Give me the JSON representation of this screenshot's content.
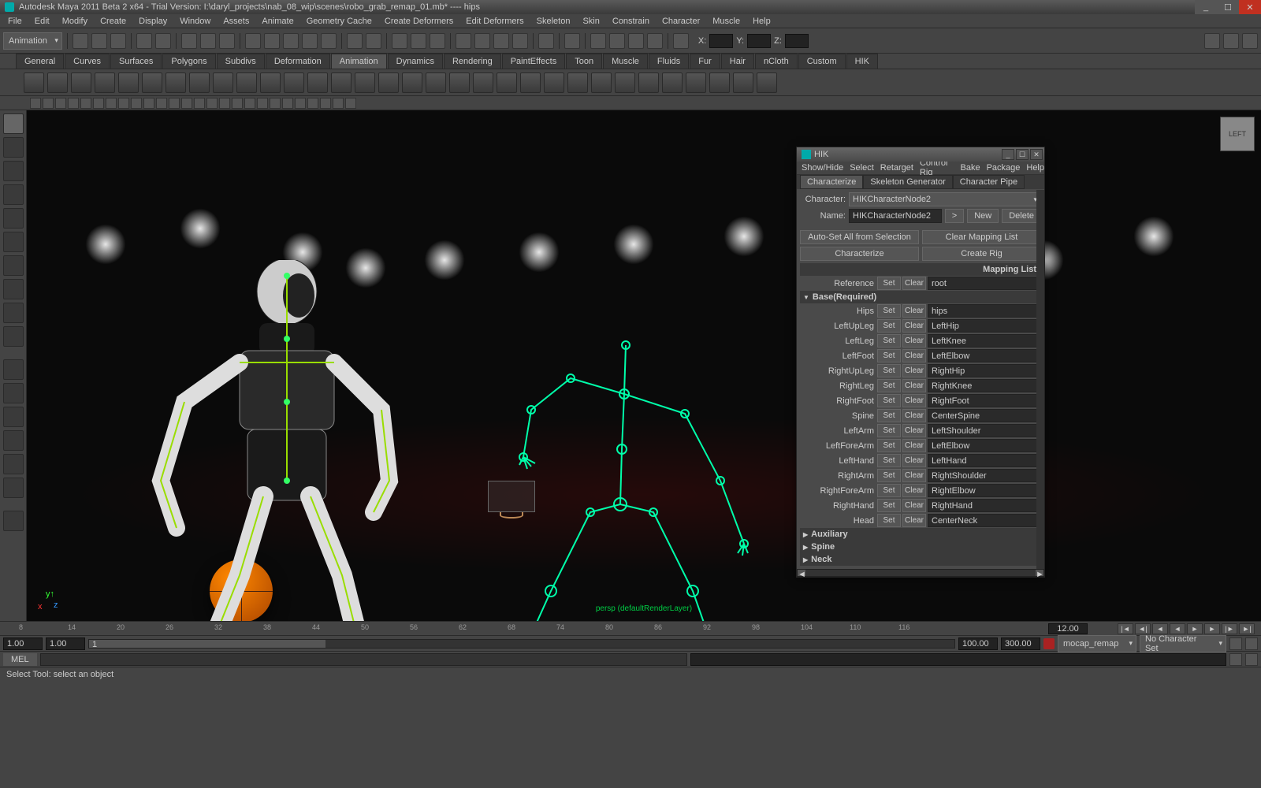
{
  "title": "Autodesk Maya 2011 Beta 2 x64 - Trial Version: I:\\daryl_projects\\nab_08_wip\\scenes\\robo_grab_remap_01.mb*  ----  hips",
  "menubar": [
    "File",
    "Edit",
    "Modify",
    "Create",
    "Display",
    "Window",
    "Assets",
    "Animate",
    "Geometry Cache",
    "Create Deformers",
    "Edit Deformers",
    "Skeleton",
    "Skin",
    "Constrain",
    "Character",
    "Muscle",
    "Help"
  ],
  "modeDropdown": "Animation",
  "xyz": {
    "x": "X:",
    "y": "Y:",
    "z": "Z:"
  },
  "shelftabs": [
    "General",
    "Curves",
    "Surfaces",
    "Polygons",
    "Subdivs",
    "Deformation",
    "Animation",
    "Dynamics",
    "Rendering",
    "PaintEffects",
    "Toon",
    "Muscle",
    "Fluids",
    "Fur",
    "Hair",
    "nCloth",
    "Custom",
    "HIK"
  ],
  "activeShelf": "Animation",
  "viewcube": "LEFT",
  "cameraLabel": "persp (defaultRenderLayer)",
  "hik": {
    "title": "HIK",
    "menu": [
      "Show/Hide",
      "Select",
      "Retarget",
      "Control Rig",
      "Bake",
      "Package",
      "Help"
    ],
    "tabs": [
      "Characterize",
      "Skeleton Generator",
      "Character Pipe"
    ],
    "activeTab": "Characterize",
    "charLabel": "Character:",
    "charValue": "HIKCharacterNode2",
    "nameLabel": "Name:",
    "nameValue": "HIKCharacterNode2",
    "newBtn": "New",
    "deleteBtn": "Delete",
    "autosetBtn": "Auto-Set All from Selection",
    "clearmapBtn": "Clear Mapping List",
    "characterizeBtn": "Characterize",
    "createrigBtn": "Create Rig",
    "mappingHeader": "Mapping List",
    "refLabel": "Reference",
    "refValue": "root",
    "setBtn": "Set",
    "clearBtn": "Clear",
    "baseSection": "Base(Required)",
    "auxSection": "Auxiliary",
    "spineSection": "Spine",
    "neckSection": "Neck",
    "bones": [
      {
        "label": "Hips",
        "value": "hips"
      },
      {
        "label": "LeftUpLeg",
        "value": "LeftHip"
      },
      {
        "label": "LeftLeg",
        "value": "LeftKnee"
      },
      {
        "label": "LeftFoot",
        "value": "LeftElbow"
      },
      {
        "label": "RightUpLeg",
        "value": "RightHip"
      },
      {
        "label": "RightLeg",
        "value": "RightKnee"
      },
      {
        "label": "RightFoot",
        "value": "RightFoot"
      },
      {
        "label": "Spine",
        "value": "CenterSpine"
      },
      {
        "label": "LeftArm",
        "value": "LeftShoulder"
      },
      {
        "label": "LeftForeArm",
        "value": "LeftElbow"
      },
      {
        "label": "LeftHand",
        "value": "LeftHand"
      },
      {
        "label": "RightArm",
        "value": "RightShoulder"
      },
      {
        "label": "RightForeArm",
        "value": "RightElbow"
      },
      {
        "label": "RightHand",
        "value": "RightHand"
      },
      {
        "label": "Head",
        "value": "CenterNeck"
      }
    ]
  },
  "time": {
    "ticks": [
      "8",
      "14",
      "20",
      "26",
      "32",
      "38",
      "44",
      "50",
      "56",
      "62",
      "68",
      "74",
      "80",
      "86",
      "92",
      "98",
      "104",
      "110",
      "116"
    ],
    "current": "12.00",
    "startA": "1.00",
    "startB": "1.00",
    "slideStart": "1",
    "endA": "100.00",
    "endB": "300.00",
    "charset": "mocap_remap",
    "nochar": "No Character Set"
  },
  "cmd": {
    "lang": "MEL"
  },
  "status": "Select Tool: select an object"
}
